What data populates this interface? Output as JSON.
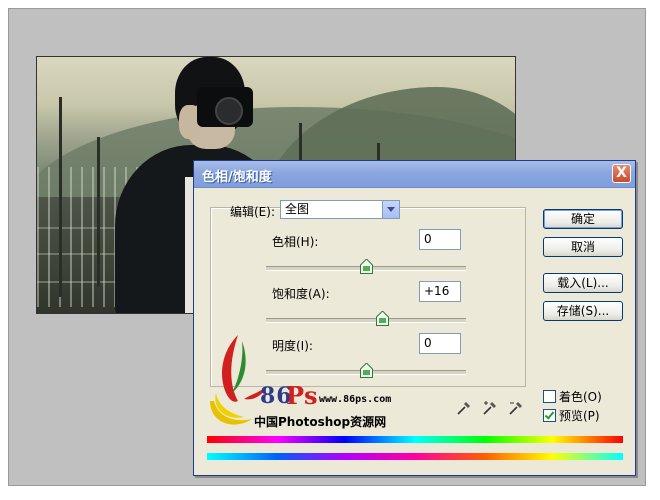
{
  "dialog": {
    "title": "色相/饱和度",
    "close_label": "X",
    "edit": {
      "label": "编辑(E):",
      "value": "全图"
    },
    "sliders": [
      {
        "label": "色相(H):",
        "value": "0",
        "level": 0
      },
      {
        "label": "饱和度(A):",
        "value": "+16",
        "level": 16
      },
      {
        "label": "明度(I):",
        "value": "0",
        "level": 0
      }
    ],
    "buttons": {
      "ok": "确定",
      "cancel": "取消",
      "load": "载入(L)...",
      "save": "存储(S)..."
    },
    "checkboxes": {
      "colorize": {
        "label": "着色(O)",
        "checked": false
      },
      "preview": {
        "label": "预览(P)",
        "checked": true
      }
    },
    "eyedroppers": [
      "eyedropper-icon",
      "eyedropper-plus-icon",
      "eyedropper-minus-icon"
    ]
  },
  "watermark": {
    "number": "86",
    "ps": "Ps",
    "url": "www.86ps.com",
    "caption": "中国Photoshop资源网"
  },
  "colors": {
    "titlebar": "#8aa7e0",
    "dialog_bg": "#ece9d8",
    "button_border": "#003c74"
  }
}
